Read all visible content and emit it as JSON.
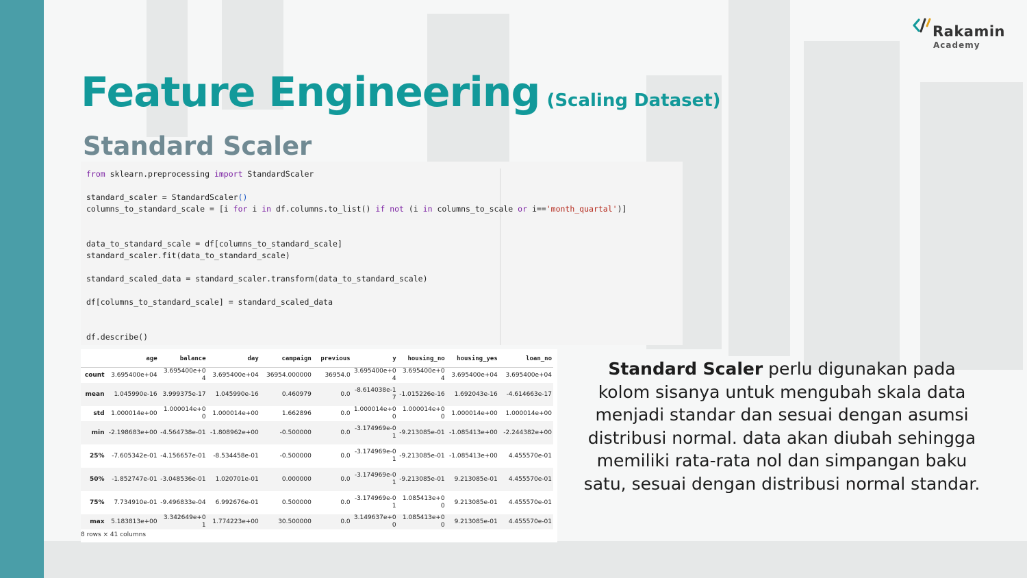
{
  "logo": {
    "name": "Rakamin",
    "sub": "Academy"
  },
  "title": {
    "main": "Feature Engineering",
    "paren": "(Scaling Dataset)"
  },
  "subtitle": "Standard Scaler",
  "code": {
    "line1_kw1": "from",
    "line1_mod": " sklearn.preprocessing ",
    "line1_kw2": "import",
    "line1_rest": " StandardScaler",
    "line2": "standard_scaler = StandardScaler",
    "line2_paren": "()",
    "line3_a": "columns_to_standard_scale = [i ",
    "line3_for": "for",
    "line3_b": " i ",
    "line3_in": "in",
    "line3_c": " df.columns.to_list() ",
    "line3_if": "if",
    "line3_sp": " ",
    "line3_not": "not",
    "line3_d": " (i ",
    "line3_in2": "in",
    "line3_e": " columns_to_scale ",
    "line3_or": "or",
    "line3_f": " i==",
    "line3_str": "'month_quartal'",
    "line3_g": ")]",
    "line4": "data_to_standard_scale = df[columns_to_standard_scale]",
    "line5": "standard_scaler.fit(data_to_standard_scale)",
    "line6": "standard_scaled_data = standard_scaler.transform(data_to_standard_scale)",
    "line7": "df[columns_to_standard_scale] = standard_scaled_data",
    "line8": "df.describe()"
  },
  "table": {
    "columns": [
      "",
      "age",
      "balance",
      "day",
      "campaign",
      "previous",
      "y",
      "housing_no",
      "housing_yes",
      "loan_no"
    ],
    "rows": [
      {
        "label": "count",
        "values": [
          "3.695400e+04",
          "3.695400e+04",
          "3.695400e+04",
          "36954.000000",
          "36954.0",
          "3.695400e+04",
          "3.695400e+04",
          "3.695400e+04",
          "3.695400e+04"
        ]
      },
      {
        "label": "mean",
        "values": [
          "1.045990e-16",
          "3.999375e-17",
          "1.045990e-16",
          "0.460979",
          "0.0",
          "-8.614038e-17",
          "-1.015226e-16",
          "1.692043e-16",
          "-4.614663e-17"
        ]
      },
      {
        "label": "std",
        "values": [
          "1.000014e+00",
          "1.000014e+00",
          "1.000014e+00",
          "1.662896",
          "0.0",
          "1.000014e+00",
          "1.000014e+00",
          "1.000014e+00",
          "1.000014e+00"
        ]
      },
      {
        "label": "min",
        "values": [
          "-2.198683e+00",
          "-4.564738e-01",
          "-1.808962e+00",
          "-0.500000",
          "0.0",
          "-3.174969e-01",
          "-9.213085e-01",
          "-1.085413e+00",
          "-2.244382e+00"
        ]
      },
      {
        "label": "25%",
        "values": [
          "-7.605342e-01",
          "-4.156657e-01",
          "-8.534458e-01",
          "-0.500000",
          "0.0",
          "-3.174969e-01",
          "-9.213085e-01",
          "-1.085413e+00",
          "4.455570e-01"
        ]
      },
      {
        "label": "50%",
        "values": [
          "-1.852747e-01",
          "-3.048536e-01",
          "1.020701e-01",
          "0.000000",
          "0.0",
          "-3.174969e-01",
          "-9.213085e-01",
          "9.213085e-01",
          "4.455570e-01"
        ]
      },
      {
        "label": "75%",
        "values": [
          "7.734910e-01",
          "-9.496833e-04",
          "6.992676e-01",
          "0.500000",
          "0.0",
          "-3.174969e-01",
          "1.085413e+00",
          "9.213085e-01",
          "4.455570e-01"
        ]
      },
      {
        "label": "max",
        "values": [
          "5.183813e+00",
          "3.342649e+01",
          "1.774223e+00",
          "30.500000",
          "0.0",
          "3.149637e+00",
          "1.085413e+00",
          "9.213085e-01",
          "4.455570e-01"
        ]
      }
    ],
    "footer": "8 rows × 41 columns"
  },
  "description": {
    "bold": "Standard Scaler",
    "text": "  perlu digunakan pada kolom sisanya untuk mengubah skala data menjadi standar dan sesuai dengan asumsi distribusi normal. data akan diubah sehingga memiliki rata-rata nol dan simpangan baku satu, sesuai dengan distribusi normal standar."
  },
  "colors": {
    "accent": "#12999a",
    "sidebar": "#4a9ea8",
    "subtitle": "#708a93"
  }
}
